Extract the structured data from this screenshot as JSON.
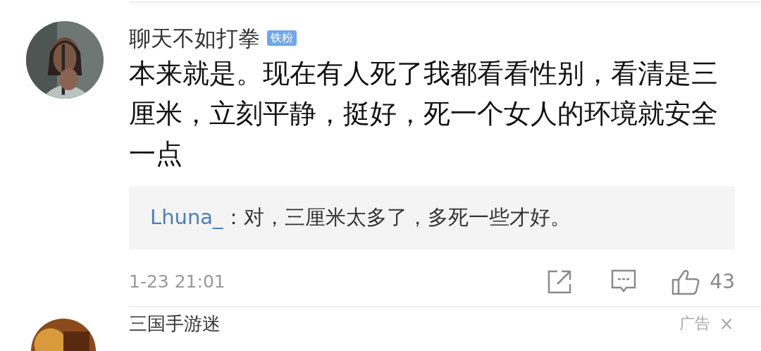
{
  "comment": {
    "username": "聊天不如打拳",
    "badge": "铁粉",
    "text": "本来就是。现在有人死了我都看看性别，看清是三厘米，立刻平静，挺好，死一个女人的环境就安全一点",
    "reply": {
      "user": "Lhuna_",
      "text": "：对，三厘米太多了，多死一些才好。"
    },
    "time": "1-23 21:01",
    "likes": "43"
  },
  "next_item": {
    "username": "三国手游迷",
    "ad_label": "广告",
    "close": "×"
  }
}
